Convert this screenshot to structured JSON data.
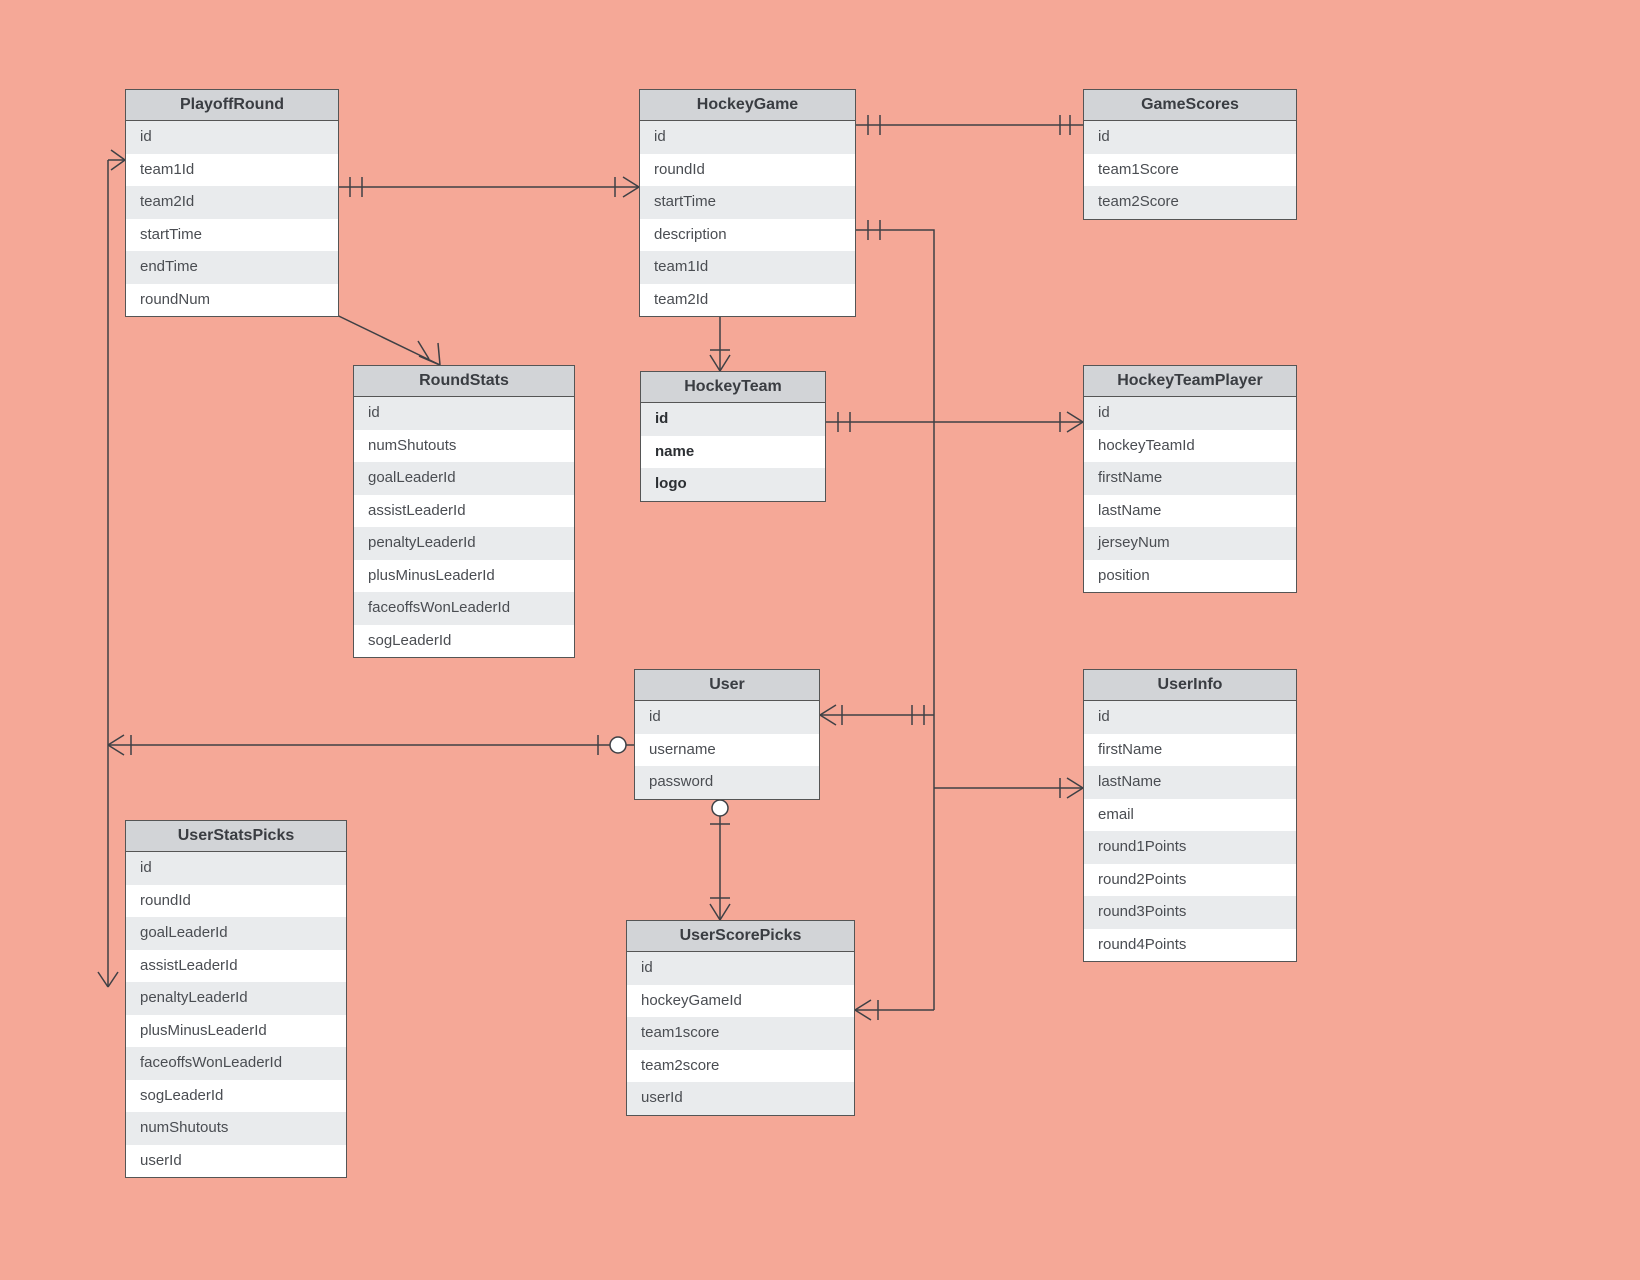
{
  "entities": {
    "PlayoffRound": {
      "title": "PlayoffRound",
      "fields": [
        "id",
        "team1Id",
        "team2Id",
        "startTime",
        "endTime",
        "roundNum"
      ]
    },
    "HockeyGame": {
      "title": "HockeyGame",
      "fields": [
        "id",
        "roundId",
        "startTime",
        "description",
        "team1Id",
        "team2Id"
      ]
    },
    "GameScores": {
      "title": "GameScores",
      "fields": [
        "id",
        "team1Score",
        "team2Score"
      ]
    },
    "RoundStats": {
      "title": "RoundStats",
      "fields": [
        "id",
        "numShutouts",
        "goalLeaderId",
        "assistLeaderId",
        "penaltyLeaderId",
        "plusMinusLeaderId",
        "faceoffsWonLeaderId",
        "sogLeaderId"
      ]
    },
    "HockeyTeam": {
      "title": "HockeyTeam",
      "fields": [
        "id",
        "name",
        "logo"
      ],
      "bold": true
    },
    "HockeyTeamPlayer": {
      "title": "HockeyTeamPlayer",
      "fields": [
        "id",
        "hockeyTeamId",
        "firstName",
        "lastName",
        "jerseyNum",
        "position"
      ]
    },
    "User": {
      "title": "User",
      "fields": [
        "id",
        "username",
        "password"
      ]
    },
    "UserInfo": {
      "title": "UserInfo",
      "fields": [
        "id",
        "firstName",
        "lastName",
        "email",
        "round1Points",
        "round2Points",
        "round3Points",
        "round4Points"
      ]
    },
    "UserStatsPicks": {
      "title": "UserStatsPicks",
      "fields": [
        "id",
        "roundId",
        "goalLeaderId",
        "assistLeaderId",
        "penaltyLeaderId",
        "plusMinusLeaderId",
        "faceoffsWonLeaderId",
        "sogLeaderId",
        "numShutouts",
        "userId"
      ]
    },
    "UserScorePicks": {
      "title": "UserScorePicks",
      "fields": [
        "id",
        "hockeyGameId",
        "team1score",
        "team2score",
        "userId"
      ]
    }
  }
}
